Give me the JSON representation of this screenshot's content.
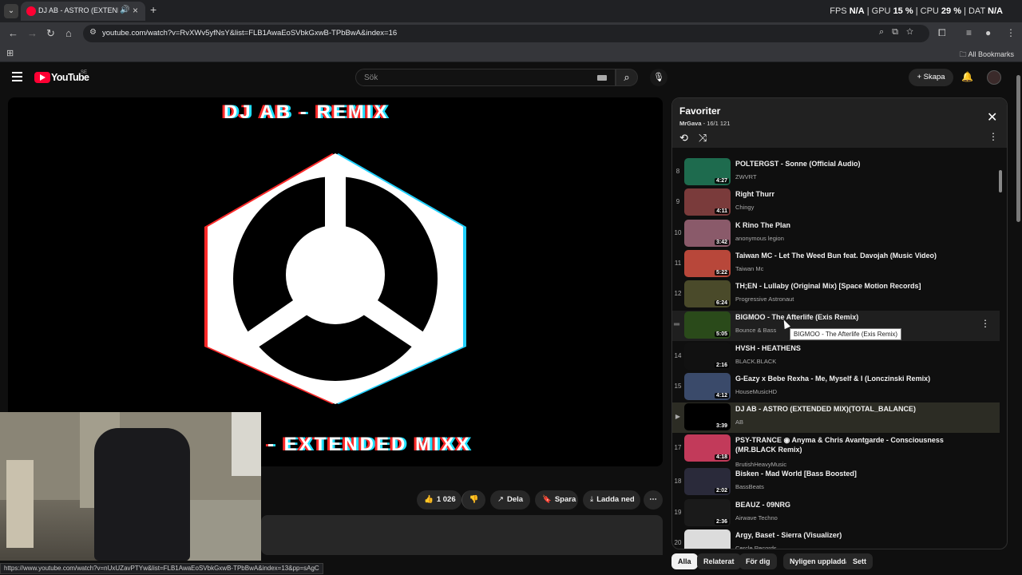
{
  "browser": {
    "tab_title": "DJ AB - ASTRO (EXTENDED",
    "url": "youtube.com/watch?v=RvXWv5yfNsY&list=FLB1AwaEoSVbkGxwB-TPbBwA&index=16",
    "all_bookmarks": "All Bookmarks",
    "status_url": "https://www.youtube.com/watch?v=nUxUZavPTYw&list=FLB1AwaEoSVbkGxwB-TPbBwA&index=13&pp=sAgC"
  },
  "perf": {
    "fps_label": "FPS",
    "fps_value": "N/A",
    "gpu_label": "GPU",
    "gpu_value": "15 %",
    "cpu_label": "CPU",
    "cpu_value": "29 %",
    "dat_label": "DAT",
    "dat_value": "N/A"
  },
  "masthead": {
    "logo_text": "YouTube",
    "country": "SE",
    "search_placeholder": "Sök",
    "create_label": "Skapa"
  },
  "video": {
    "overlay_title": "DJ AB - REMIX",
    "overlay_subtitle": "- EXTENDED MIXX"
  },
  "actions": {
    "like_count": "1 026",
    "share": "Dela",
    "save": "Spara",
    "download": "Ladda ned"
  },
  "playlist": {
    "title": "Favoriter",
    "owner": "MrGava",
    "position": "16/1 121",
    "tooltip": "BIGMOO - The Afterlife (Exis Remix)",
    "items": [
      {
        "index": "8",
        "title": "POLTERGST - Sonne (Official Audio)",
        "channel": "ZWVRT",
        "duration": "4:27",
        "thumb": "#1e6b4e"
      },
      {
        "index": "9",
        "title": "Right Thurr",
        "channel": "Chingy",
        "duration": "4:11",
        "thumb": "#7a3b3b"
      },
      {
        "index": "10",
        "title": "K Rino The Plan",
        "channel": "anonymous legion",
        "duration": "3:42",
        "thumb": "#8a5a6a"
      },
      {
        "index": "11",
        "title": "Taiwan MC - Let The Weed Bun feat. Davojah (Music Video)",
        "channel": "Taiwan Mc",
        "duration": "5:22",
        "thumb": "#b8473a"
      },
      {
        "index": "12",
        "title": "TH;EN - Lullaby (Original Mix) [Space Motion Records]",
        "channel": "Progressive Astronaut",
        "duration": "6:24",
        "thumb": "#4a4a2a"
      },
      {
        "index": "",
        "title": "BIGMOO - The Afterlife (Exis Remix)",
        "channel": "Bounce & Bass",
        "duration": "5:05",
        "thumb": "#2a4a1a"
      },
      {
        "index": "14",
        "title": "HVSH - HEATHENS",
        "channel": "BLACK.BLACK",
        "duration": "2:16",
        "thumb": "#111111"
      },
      {
        "index": "15",
        "title": "G-Eazy x Bebe Rexha - Me, Myself & I (Lonczinski Remix)",
        "channel": "HouseMusicHD",
        "duration": "4:12",
        "thumb": "#3a4a6a"
      },
      {
        "index": "",
        "title": "DJ AB - ASTRO (EXTENDED MIX)(TOTAL_BALANCE)",
        "channel": "AB",
        "duration": "3:39",
        "thumb": "#000000"
      },
      {
        "index": "17",
        "title": "PSY-TRANCE ◉ Anyma & Chris Avantgarde - Consciousness (MR.BLACK Remix)",
        "channel": "BrutishHeavyMusic",
        "duration": "4:18",
        "thumb": "#c23a5a"
      },
      {
        "index": "18",
        "title": "Bisken - Mad World [Bass Boosted]",
        "channel": "BassBeats",
        "duration": "2:02",
        "thumb": "#2a2a3a"
      },
      {
        "index": "19",
        "title": "BEAUZ - 09NRG",
        "channel": "Airwave Techno",
        "duration": "2:36",
        "thumb": "#1a1a1a"
      },
      {
        "index": "20",
        "title": "Argy, Baset - Sierra (Visualizer)",
        "channel": "Cercle Records",
        "duration": "",
        "thumb": "#dcdcdc"
      }
    ]
  },
  "chips": [
    "Alla",
    "Relaterat",
    "För dig",
    "Nyligen uppladdat",
    "Sett"
  ]
}
